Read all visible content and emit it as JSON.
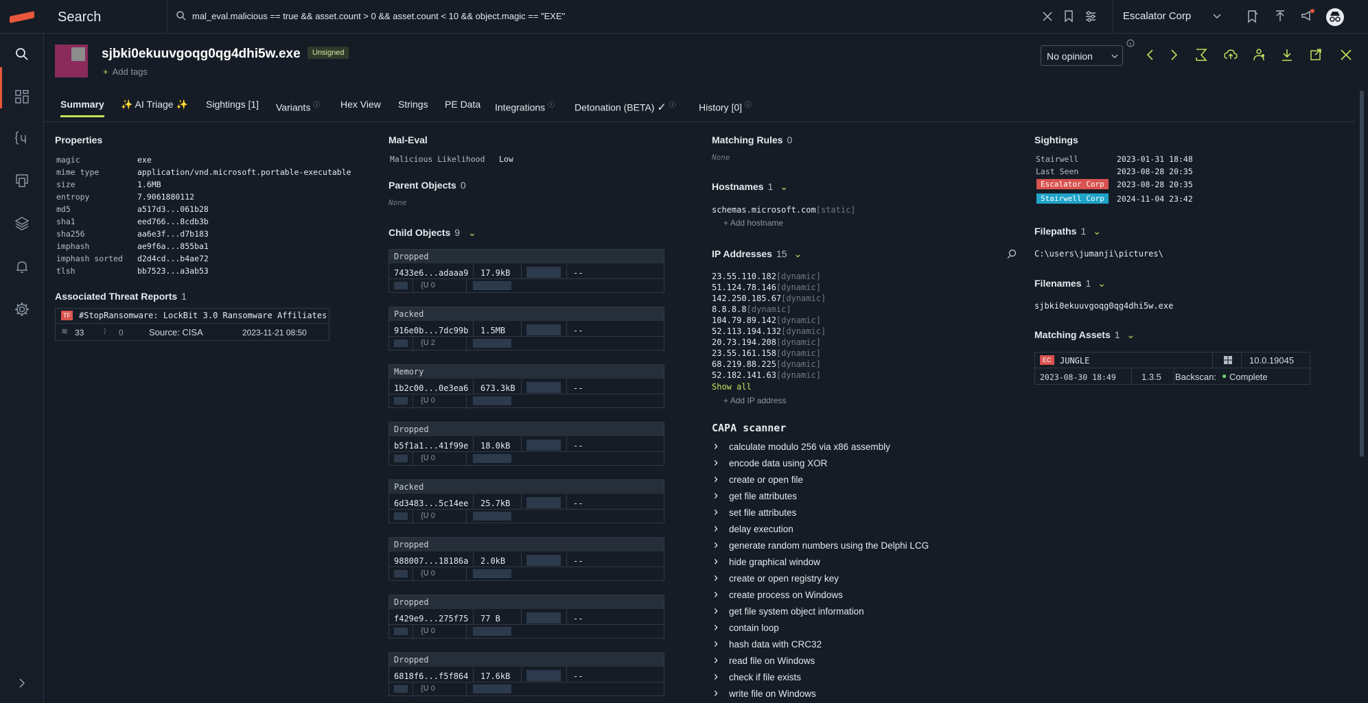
{
  "topbar": {
    "search_title": "Search",
    "query": "mal_eval.malicious == true && asset.count > 0 && asset.count < 10 && object.magic == \"EXE\"",
    "org_name": "Escalator Corp"
  },
  "header": {
    "file_name": "sjbki0ekuuvgoqg0qg4dhi5w.exe",
    "signed_badge": "Unsigned",
    "add_tags": "Add tags",
    "opinion": "No opinion"
  },
  "tabs": [
    {
      "label": "Summary"
    },
    {
      "label": "✨ AI Triage ✨"
    },
    {
      "label": "Sightings [1]"
    },
    {
      "label": "Variants"
    },
    {
      "label": "Hex View"
    },
    {
      "label": "Strings"
    },
    {
      "label": "PE Data"
    },
    {
      "label": "Integrations"
    },
    {
      "label": "Detonation (BETA)"
    },
    {
      "label": "History [0]"
    }
  ],
  "properties": {
    "title": "Properties",
    "rows": [
      {
        "k": "magic",
        "v": "exe"
      },
      {
        "k": "mime type",
        "v": "application/vnd.microsoft.portable-executable"
      },
      {
        "k": "size",
        "v": "1.6MB"
      },
      {
        "k": "entropy",
        "v": "7.9061880112"
      },
      {
        "k": "md5",
        "v": "a517d3...061b28"
      },
      {
        "k": "sha1",
        "v": "eed766...8cdb3b"
      },
      {
        "k": "sha256",
        "v": "aa6e3f...d7b183"
      },
      {
        "k": "imphash",
        "v": "ae9f6a...855ba1"
      },
      {
        "k": "imphash sorted",
        "v": "d2d4cd...b4ae72"
      },
      {
        "k": "tlsh",
        "v": "bb7523...a3ab53"
      }
    ]
  },
  "threat_reports": {
    "title": "Associated Threat Reports",
    "count": "1",
    "report": {
      "badge": "TF",
      "name": "#StopRansomware: LockBit 3.0 Ransomware Affiliates",
      "fingerprints": "33",
      "other": "0",
      "source": "Source: CISA",
      "date": "2023-11-21 08:50"
    }
  },
  "mal_eval": {
    "title": "Mal-Eval",
    "label": "Malicious Likelihood",
    "value": "Low"
  },
  "parent_objects": {
    "title": "Parent Objects",
    "count": "0",
    "none": "None"
  },
  "child_objects": {
    "title": "Child Objects",
    "count": "9",
    "items": [
      {
        "type": "Dropped",
        "hash": "7433e6...adaaa9",
        "size": "17.9kB",
        "dash": "--",
        "cnt": "0"
      },
      {
        "type": "Packed",
        "hash": "916e0b...7dc99b",
        "size": "1.5MB",
        "dash": "--",
        "cnt": "2"
      },
      {
        "type": "Memory",
        "hash": "1b2c00...0e3ea6",
        "size": "673.3kB",
        "dash": "--",
        "cnt": "0"
      },
      {
        "type": "Dropped",
        "hash": "b5f1a1...41f99e",
        "size": "18.0kB",
        "dash": "--",
        "cnt": "0"
      },
      {
        "type": "Packed",
        "hash": "6d3483...5c14ee",
        "size": "25.7kB",
        "dash": "--",
        "cnt": "0"
      },
      {
        "type": "Dropped",
        "hash": "988007...18186a",
        "size": "2.0kB",
        "dash": "--",
        "cnt": "0"
      },
      {
        "type": "Dropped",
        "hash": "f429e9...275f75",
        "size": "77 B",
        "dash": "--",
        "cnt": "0"
      },
      {
        "type": "Dropped",
        "hash": "6818f6...f5f864",
        "size": "17.6kB",
        "dash": "--",
        "cnt": "0"
      }
    ]
  },
  "matching_rules": {
    "title": "Matching Rules",
    "count": "0",
    "none": "None"
  },
  "hostnames": {
    "title": "Hostnames",
    "count": "1",
    "host": "schemas.microsoft.com",
    "tag": "[static]",
    "add": "Add hostname"
  },
  "ip_addresses": {
    "title": "IP Addresses",
    "count": "15",
    "tag": "[dynamic]",
    "ips": [
      "23.55.110.182",
      "51.124.78.146",
      "142.250.185.67",
      "8.8.8.8",
      "104.79.89.142",
      "52.113.194.132",
      "20.73.194.208",
      "23.55.161.158",
      "68.219.88.225",
      "52.182.141.63"
    ],
    "show_all": "Show all",
    "add": "Add IP address"
  },
  "capa": {
    "title": "CAPA scanner",
    "items": [
      "calculate modulo 256 via x86 assembly",
      "encode data using XOR",
      "create or open file",
      "get file attributes",
      "set file attributes",
      "delay execution",
      "generate random numbers using the Delphi LCG",
      "hide graphical window",
      "create or open registry key",
      "create process on Windows",
      "get file system object information",
      "contain loop",
      "hash data with CRC32",
      "read file on Windows",
      "check if file exists",
      "write file on Windows"
    ]
  },
  "sightings": {
    "title": "Sightings",
    "rows": [
      {
        "k": "Stairwell",
        "v": "2023-01-31 18:48"
      },
      {
        "k": "Last Seen",
        "v": "2023-08-28 20:35"
      },
      {
        "k": "Escalator Corp",
        "v": "2023-08-28 20:35"
      },
      {
        "k": "Stairwell Corp",
        "v": "2024-11-04 23:42"
      }
    ]
  },
  "filepaths": {
    "title": "Filepaths",
    "count": "1",
    "path": "C:\\users\\jumanji\\pictures\\"
  },
  "filenames": {
    "title": "Filenames",
    "count": "1",
    "name": "sjbki0ekuuvgoqg0qg4dhi5w.exe"
  },
  "matching_assets": {
    "title": "Matching Assets",
    "count": "1",
    "badge": "EC",
    "host": "JUNGLE",
    "os_version": "10.0.19045",
    "date": "2023-08-30 18:49",
    "agent_version": "1.3.5",
    "backscan_label": "Backscan:",
    "backscan_status": "Complete"
  },
  "colors": {
    "accent": "#c6e05a",
    "brand": "#e8573c",
    "escalator": "#d9534f",
    "stairwell": "#1fa3c9"
  }
}
